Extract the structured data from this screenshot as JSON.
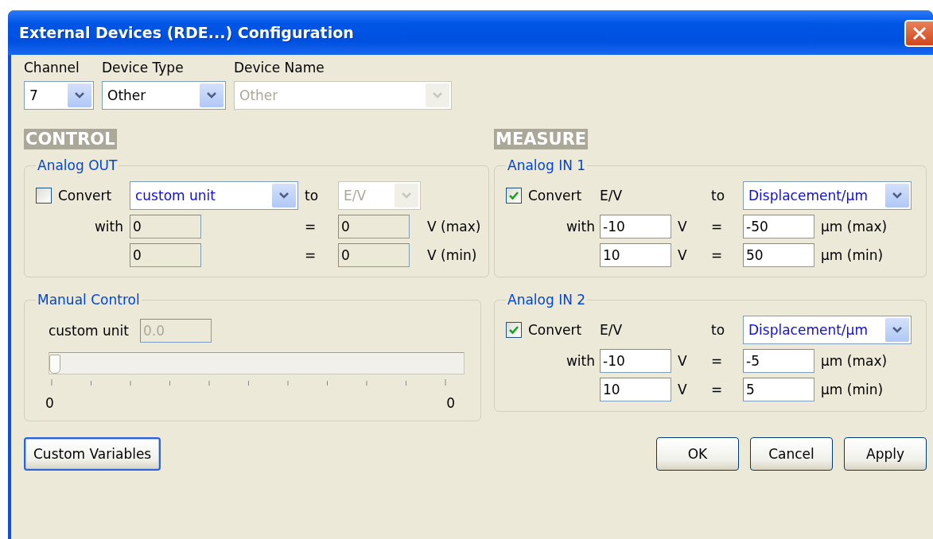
{
  "window": {
    "title": "External Devices (RDE...) Configuration"
  },
  "selectors": [
    {
      "label": "Channel",
      "value": "7",
      "disabled": false
    },
    {
      "label": "Device Type",
      "value": "Other",
      "disabled": false
    },
    {
      "label": "Device Name",
      "value": "Other",
      "disabled": true
    }
  ],
  "control": {
    "heading": "CONTROL",
    "analog_out": {
      "title": "Analog OUT",
      "convert": {
        "label": "Convert",
        "checked": false
      },
      "unit": {
        "value": "custom unit",
        "disabled": false
      },
      "to_label": "to",
      "target": {
        "value": "E/V",
        "disabled": true
      },
      "with_label": "with",
      "rows": [
        {
          "from": "0",
          "eq": "=",
          "to": "0",
          "unit": "V (max)",
          "disabled": true
        },
        {
          "from": "0",
          "eq": "=",
          "to": "0",
          "unit": "V (min)",
          "disabled": true
        }
      ]
    },
    "manual": {
      "title": "Manual Control",
      "field_label": "custom unit",
      "field_value": "0.0",
      "field_disabled": true,
      "level": 0,
      "min_label": "0",
      "max_label": "0"
    }
  },
  "measure": {
    "heading": "MEASURE",
    "inputs": [
      {
        "title": "Analog IN 1",
        "convert": {
          "label": "Convert",
          "checked": true
        },
        "source": "E/V",
        "to_label": "to",
        "target": {
          "value": "Displacement/µm",
          "disabled": false
        },
        "with_label": "with",
        "rows": [
          {
            "from": "-10",
            "from_unit": "V",
            "eq": "=",
            "to": "-50",
            "to_unit": "µm (max)",
            "disabled": false
          },
          {
            "from": "10",
            "from_unit": "V",
            "eq": "=",
            "to": "50",
            "to_unit": "µm (min)",
            "disabled": false
          }
        ]
      },
      {
        "title": "Analog IN 2",
        "convert": {
          "label": "Convert",
          "checked": true
        },
        "source": "E/V",
        "to_label": "to",
        "target": {
          "value": "Displacement/µm",
          "disabled": false
        },
        "with_label": "with",
        "rows": [
          {
            "from": "-10",
            "from_unit": "V",
            "eq": "=",
            "to": "-5",
            "to_unit": "µm (max)",
            "disabled": false
          },
          {
            "from": "10",
            "from_unit": "V",
            "eq": "=",
            "to": "5",
            "to_unit": "µm (min)",
            "disabled": false
          }
        ]
      }
    ]
  },
  "left_buttons": [
    {
      "label": "Custom Variables",
      "focused": true
    }
  ],
  "right_buttons": [
    {
      "label": "OK",
      "focused": false
    },
    {
      "label": "Cancel",
      "focused": false
    },
    {
      "label": "Apply",
      "focused": false
    }
  ]
}
